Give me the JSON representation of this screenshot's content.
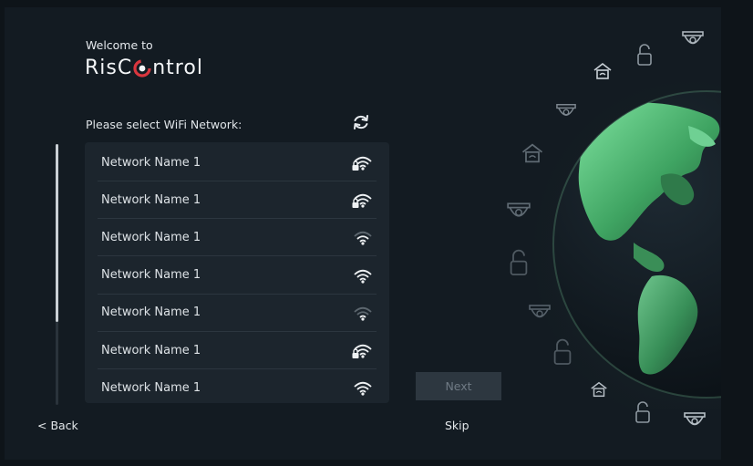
{
  "header": {
    "welcome": "Welcome to",
    "brand_before": "RisC",
    "brand_after": "ntrol"
  },
  "wifi": {
    "prompt": "Please select WiFi Network:",
    "refresh_icon": "refresh-icon",
    "networks": [
      {
        "name": "Network Name 1",
        "secured": true,
        "signal": "strong"
      },
      {
        "name": "Network Name 1",
        "secured": true,
        "signal": "strong"
      },
      {
        "name": "Network Name 1",
        "secured": false,
        "signal": "medium"
      },
      {
        "name": "Network Name 1",
        "secured": false,
        "signal": "strong"
      },
      {
        "name": "Network Name 1",
        "secured": false,
        "signal": "weak"
      },
      {
        "name": "Network Name 1",
        "secured": true,
        "signal": "strong"
      },
      {
        "name": "Network Name 1",
        "secured": false,
        "signal": "strong"
      }
    ]
  },
  "footer": {
    "back_label": "< Back",
    "next_label": "Next",
    "skip_label": "Skip"
  },
  "colors": {
    "background": "#131b22",
    "list_bg": "#1c252d",
    "brand_red": "#d9363e",
    "globe_green": "#3fa462",
    "button_disabled": "#2d3740"
  }
}
